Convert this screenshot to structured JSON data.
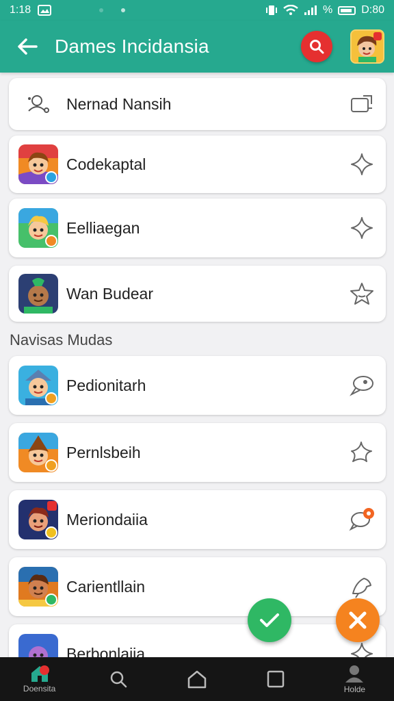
{
  "status_bar": {
    "time": "1:18",
    "right_text": "%",
    "clock_right": "D:80"
  },
  "app_bar": {
    "title": "Dames Incidansia"
  },
  "top_item": {
    "label": "Nernad Nansih"
  },
  "favorites": [
    {
      "label": "Codekaptal",
      "icon_color": "#f08a24",
      "badge_color": "#2aa3e0"
    },
    {
      "label": "Eelliaegan",
      "icon_color": "#46c06a",
      "badge_color": "#f08a24"
    },
    {
      "label": "Wan Budear",
      "icon_color": "#2c3f73",
      "badge_color": ""
    }
  ],
  "section": {
    "title": "Navisas Mudas"
  },
  "apps": [
    {
      "label": "Pedionitarh",
      "icon_color": "#3ab0e0",
      "badge_color": "#f0a020"
    },
    {
      "label": "Pernlsbeih",
      "icon_color": "#f08a24",
      "badge_color": "#f0a020"
    },
    {
      "label": "Meriondaiia",
      "icon_color": "#23306e",
      "badge_color": "#f0c020"
    },
    {
      "label": "Carientllain",
      "icon_color": "#e07a20",
      "badge_color": "#2fb864"
    },
    {
      "label": "Berbonlaiia",
      "icon_color": "#3a6ad0",
      "badge_color": ""
    }
  ],
  "bottom_nav": [
    {
      "label": "Doensita",
      "icon": "home-filled-icon"
    },
    {
      "label": "",
      "icon": "search-icon"
    },
    {
      "label": "",
      "icon": "home-outline-icon"
    },
    {
      "label": "",
      "icon": "square-icon"
    },
    {
      "label": "Holde",
      "icon": "person-icon"
    }
  ],
  "colors": {
    "primary": "#26a98f",
    "search": "#e53030",
    "fab_green": "#2fb864",
    "fab_orange": "#f5831f"
  }
}
